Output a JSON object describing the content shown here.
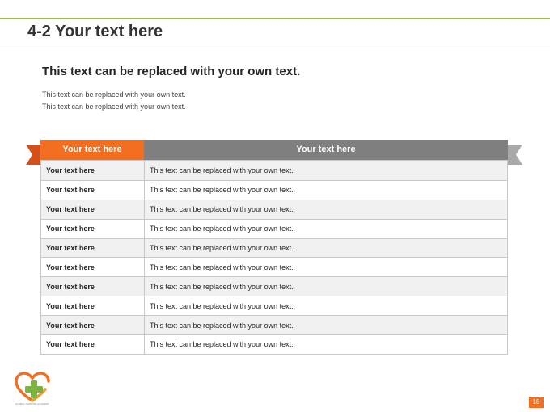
{
  "header": {
    "title": "4-2 Your text here"
  },
  "content": {
    "subtitle": "This text can be replaced with your own text.",
    "lines": [
      "This text can be replaced with your own text.",
      "This text can be replaced with your own text."
    ]
  },
  "table": {
    "headers": [
      "Your text here",
      "Your text here"
    ],
    "rows": [
      [
        "Your text here",
        "This text can be replaced with your own text."
      ],
      [
        "Your text here",
        "This text can be replaced with your own text."
      ],
      [
        "Your text here",
        "This text can be replaced with your own text."
      ],
      [
        "Your text here",
        "This text can be replaced with your own text."
      ],
      [
        "Your text here",
        "This text can be replaced with your own text."
      ],
      [
        "Your text here",
        "This text can be replaced with your own text."
      ],
      [
        "Your text here",
        "This text can be replaced with your own text."
      ],
      [
        "Your text here",
        "This text can be replaced with your own text."
      ],
      [
        "Your text here",
        "This text can be replaced with your own text."
      ],
      [
        "Your text here",
        "This text can be replaced with your own text."
      ]
    ]
  },
  "footer": {
    "logo_text": "GLOBAL NURSING ACADEMY",
    "page_number": "18"
  },
  "colors": {
    "accent_orange": "#f26f21",
    "header_gray": "#7f7f7f",
    "rule_green": "#9dc14a"
  }
}
